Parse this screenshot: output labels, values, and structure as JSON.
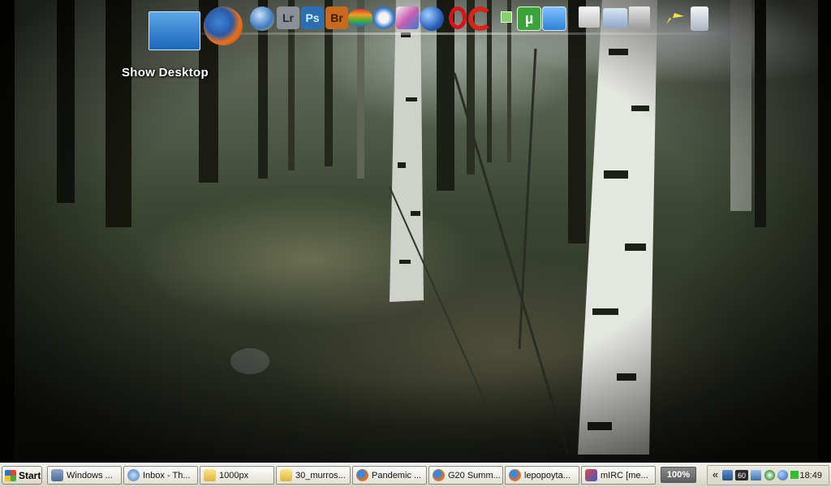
{
  "desktop": {
    "show_desktop_label": "Show Desktop"
  },
  "dock": {
    "icons": [
      "show-desktop-icon",
      "firefox-icon",
      "thunderbird-icon",
      "lightroom-icon",
      "photoshop-icon",
      "bridge-icon",
      "rainbow-app-icon",
      "safari-icon",
      "pidgin-icon",
      "google-earth-icon",
      "opera-icon",
      "ccleaner-icon",
      "small-window-icon",
      "utorrent-icon",
      "blue-square-icon",
      "document-icon",
      "folder-icon",
      "trash-folder-icon",
      "airplane-icon",
      "recycle-bin-icon"
    ],
    "lightroom_label": "Lr",
    "photoshop_label": "Ps",
    "bridge_label": "Br",
    "utorrent_label": "µ"
  },
  "taskbar": {
    "start_label": "Start",
    "tasks": [
      {
        "label": "Windows ...",
        "icon": "window-icon"
      },
      {
        "label": "Inbox - Th...",
        "icon": "thunderbird-icon"
      },
      {
        "label": "1000px",
        "icon": "folder-icon"
      },
      {
        "label": "30_murros...",
        "icon": "folder-icon"
      },
      {
        "label": "Pandemic ...",
        "icon": "firefox-icon"
      },
      {
        "label": "G20 Summ...",
        "icon": "firefox-icon"
      },
      {
        "label": "lepopoyta...",
        "icon": "firefox-icon"
      },
      {
        "label": "mIRC [me...",
        "icon": "mirc-icon"
      }
    ],
    "zoom_label": "100%",
    "tray": {
      "expand_label": "«",
      "temperature": "60",
      "clock": "18:49"
    }
  },
  "colors": {
    "taskbar_bg": "#e6e3d9",
    "firefox_orange": "#e8701a",
    "photoshop_blue": "#2b6fb3",
    "bridge_orange": "#c86a1e",
    "utorrent_green": "#3aa33a"
  }
}
